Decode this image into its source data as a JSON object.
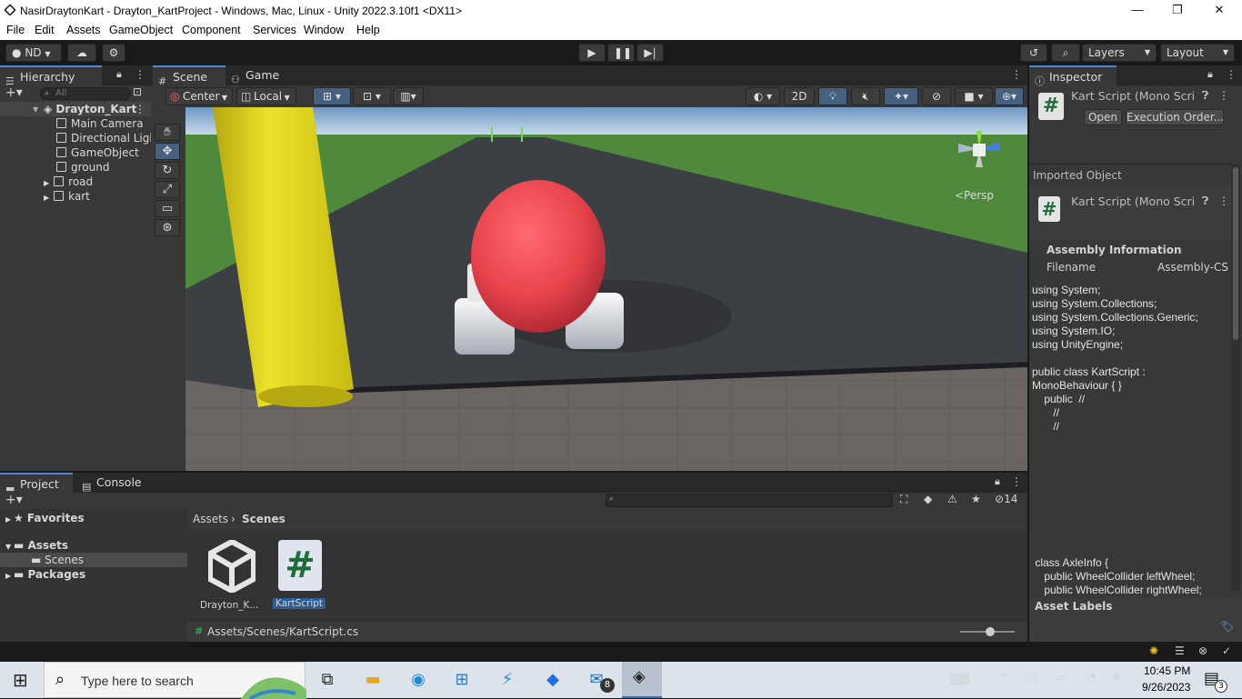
{
  "window": {
    "title": "NasirDraytonKart - Drayton_KartProject - Windows, Mac, Linux - Unity 2022.3.10f1 <DX11>",
    "controls": [
      "—",
      "❐",
      "✕"
    ]
  },
  "menu": [
    "File",
    "Edit",
    "Assets",
    "GameObject",
    "Component",
    "Services",
    "Window",
    "Help"
  ],
  "toolbar": {
    "account": "ND",
    "layers": "Layers",
    "layout": "Layout"
  },
  "hierarchy": {
    "tab": "Hierarchy",
    "search_placeholder": "All",
    "scene": "Drayton_Kart",
    "items": [
      "Main Camera",
      "Directional Light",
      "GameObject",
      "ground",
      "road",
      "kart"
    ]
  },
  "scene_view": {
    "tabs": [
      "Scene",
      "Game"
    ],
    "pivot": "Center",
    "space": "Local",
    "mode_2d": "2D",
    "persp_label": "<Persp"
  },
  "inspector": {
    "tab": "Inspector",
    "title": "Kart Script (Mono Scri",
    "open": "Open",
    "exec_order": "Execution Order...",
    "imported": "Imported Object",
    "imported_title": "Kart Script (Mono Scri",
    "assembly_header": "Assembly Information",
    "filename_label": "Filename",
    "filename_value": "Assembly-CS",
    "code_top": "using System;\nusing System.Collections;\nusing System.Collections.Generic;\nusing System.IO;\nusing UnityEngine;\n\npublic class KartScript :\nMonoBehaviour { }\n    public  //\n       //\n       //",
    "code_bottom": " class AxleInfo {\n    public WheelCollider leftWheel;\n    public WheelCollider rightWheel;",
    "asset_labels": "Asset Labels"
  },
  "project": {
    "tabs": [
      "Project",
      "Console"
    ],
    "hidden_count": "14",
    "favorites": "Favorites",
    "assets": "Assets",
    "scenes": "Scenes",
    "packages": "Packages",
    "breadcrumb": [
      "Assets",
      "Scenes"
    ],
    "files": [
      {
        "name": "Drayton_K...",
        "kind": "scene"
      },
      {
        "name": "KartScript",
        "kind": "script"
      }
    ],
    "footer_path": "Assets/Scenes/KartScript.cs"
  },
  "taskbar": {
    "search_placeholder": "Type here to search",
    "time": "10:45 PM",
    "date": "9/26/2023",
    "mail_badge": "8",
    "notif_badge": "3"
  },
  "colors": {
    "unity_dark": "#191919",
    "panel": "#383838",
    "accent": "#4a85d6",
    "sky": "#8fb4d6",
    "grass": "#4f8a3c",
    "road": "#3c3f44",
    "ball": "#e8434b",
    "pole": "#e6d622",
    "taskbar": "#dde3ea"
  }
}
